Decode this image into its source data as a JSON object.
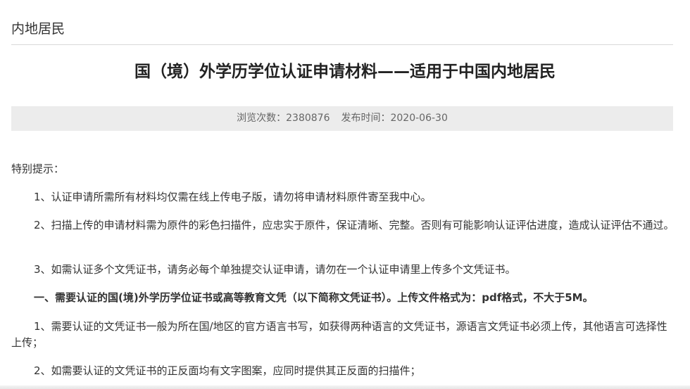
{
  "section": {
    "title": "内地居民"
  },
  "article": {
    "title": "国（境）外学历学位认证申请材料——适用于中国内地居民",
    "meta": {
      "views_label": "浏览次数：",
      "views_value": "2380876",
      "date_label": "发布时间：",
      "date_value": "2020-06-30"
    },
    "notice_heading": "特别提示：",
    "notices": [
      "1、认证申请所需所有材料均仅需在线上传电子版，请勿将申请材料原件寄至我中心。",
      "2、扫描上传的申请材料需为原件的彩色扫描件，应忠实于原件，保证清晰、完整。否则有可能影响认证评估进度，造成认证评估不通过。",
      "3、如需认证多个文凭证书，请务必每个单独提交认证申请，请勿在一个认证申请里上传多个文凭证书。"
    ],
    "section1_heading": "一、需要认证的国(境)外学历学位证书或高等教育文凭（以下简称文凭证书）。上传文件格式为：pdf格式，不大于5M。",
    "section1_items": [
      "1、需要认证的文凭证书一般为所在国/地区的官方语言书写，如获得两种语言的文凭证书，源语言文凭证书必须上传，其他语言可选择性上传；",
      "2、如需要认证的文凭证书的正反面均有文字图案，应同时提供其正反面的扫描件；"
    ]
  }
}
